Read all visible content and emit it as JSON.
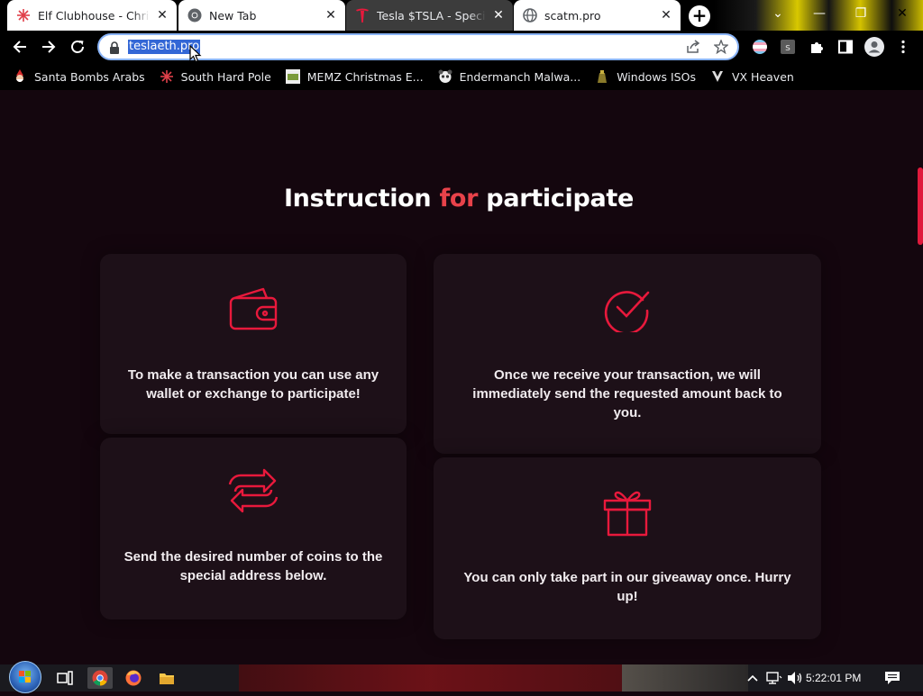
{
  "browser": {
    "tabs": [
      {
        "title": "Elf Clubhouse - Christmas",
        "favicon": "snowflake-icon",
        "active": false
      },
      {
        "title": "New Tab",
        "favicon": "chrome-icon",
        "active": false
      },
      {
        "title": "Tesla $TSLA - Special Event",
        "favicon": "tesla-icon",
        "active": true
      },
      {
        "title": "scatm.pro",
        "favicon": "globe-icon",
        "active": false
      }
    ],
    "window_controls": {
      "minimize": "—",
      "restore": "❐",
      "close": "✕"
    },
    "url": "teslaeth.pro",
    "bookmarks": [
      {
        "label": "Santa Bombs Arabs",
        "icon": "santa-icon"
      },
      {
        "label": "South Hard Pole",
        "icon": "snowflake-icon"
      },
      {
        "label": "MEMZ Christmas E...",
        "icon": "memz-icon"
      },
      {
        "label": "Endermanch Malwa...",
        "icon": "panda-icon"
      },
      {
        "label": "Windows ISOs",
        "icon": "windows-iso-icon"
      },
      {
        "label": "VX Heaven",
        "icon": "vx-heaven-icon"
      }
    ]
  },
  "page": {
    "heading": {
      "part1": "Instruction",
      "accent": "for",
      "part2": "participate"
    },
    "cards": [
      {
        "icon": "wallet-icon",
        "text": "To make a transaction you can use any wallet or exchange to participate!"
      },
      {
        "icon": "check-circle-icon",
        "text": "Once we receive your transaction, we will immediately send the requested amount back to you."
      },
      {
        "icon": "swap-arrows-icon",
        "text": "Send the desired number of coins to the special address below."
      },
      {
        "icon": "gift-icon",
        "text": "You can only take part in our giveaway once. Hurry up!"
      }
    ],
    "colors": {
      "background": "#14060e",
      "card": "#1d1018",
      "accent": "#e8193c",
      "heading_accent": "#e8424a"
    }
  },
  "taskbar": {
    "clock": "5:22:01 PM",
    "apps": [
      "task-view-icon",
      "chrome-icon",
      "firefox-icon",
      "file-explorer-icon"
    ]
  }
}
